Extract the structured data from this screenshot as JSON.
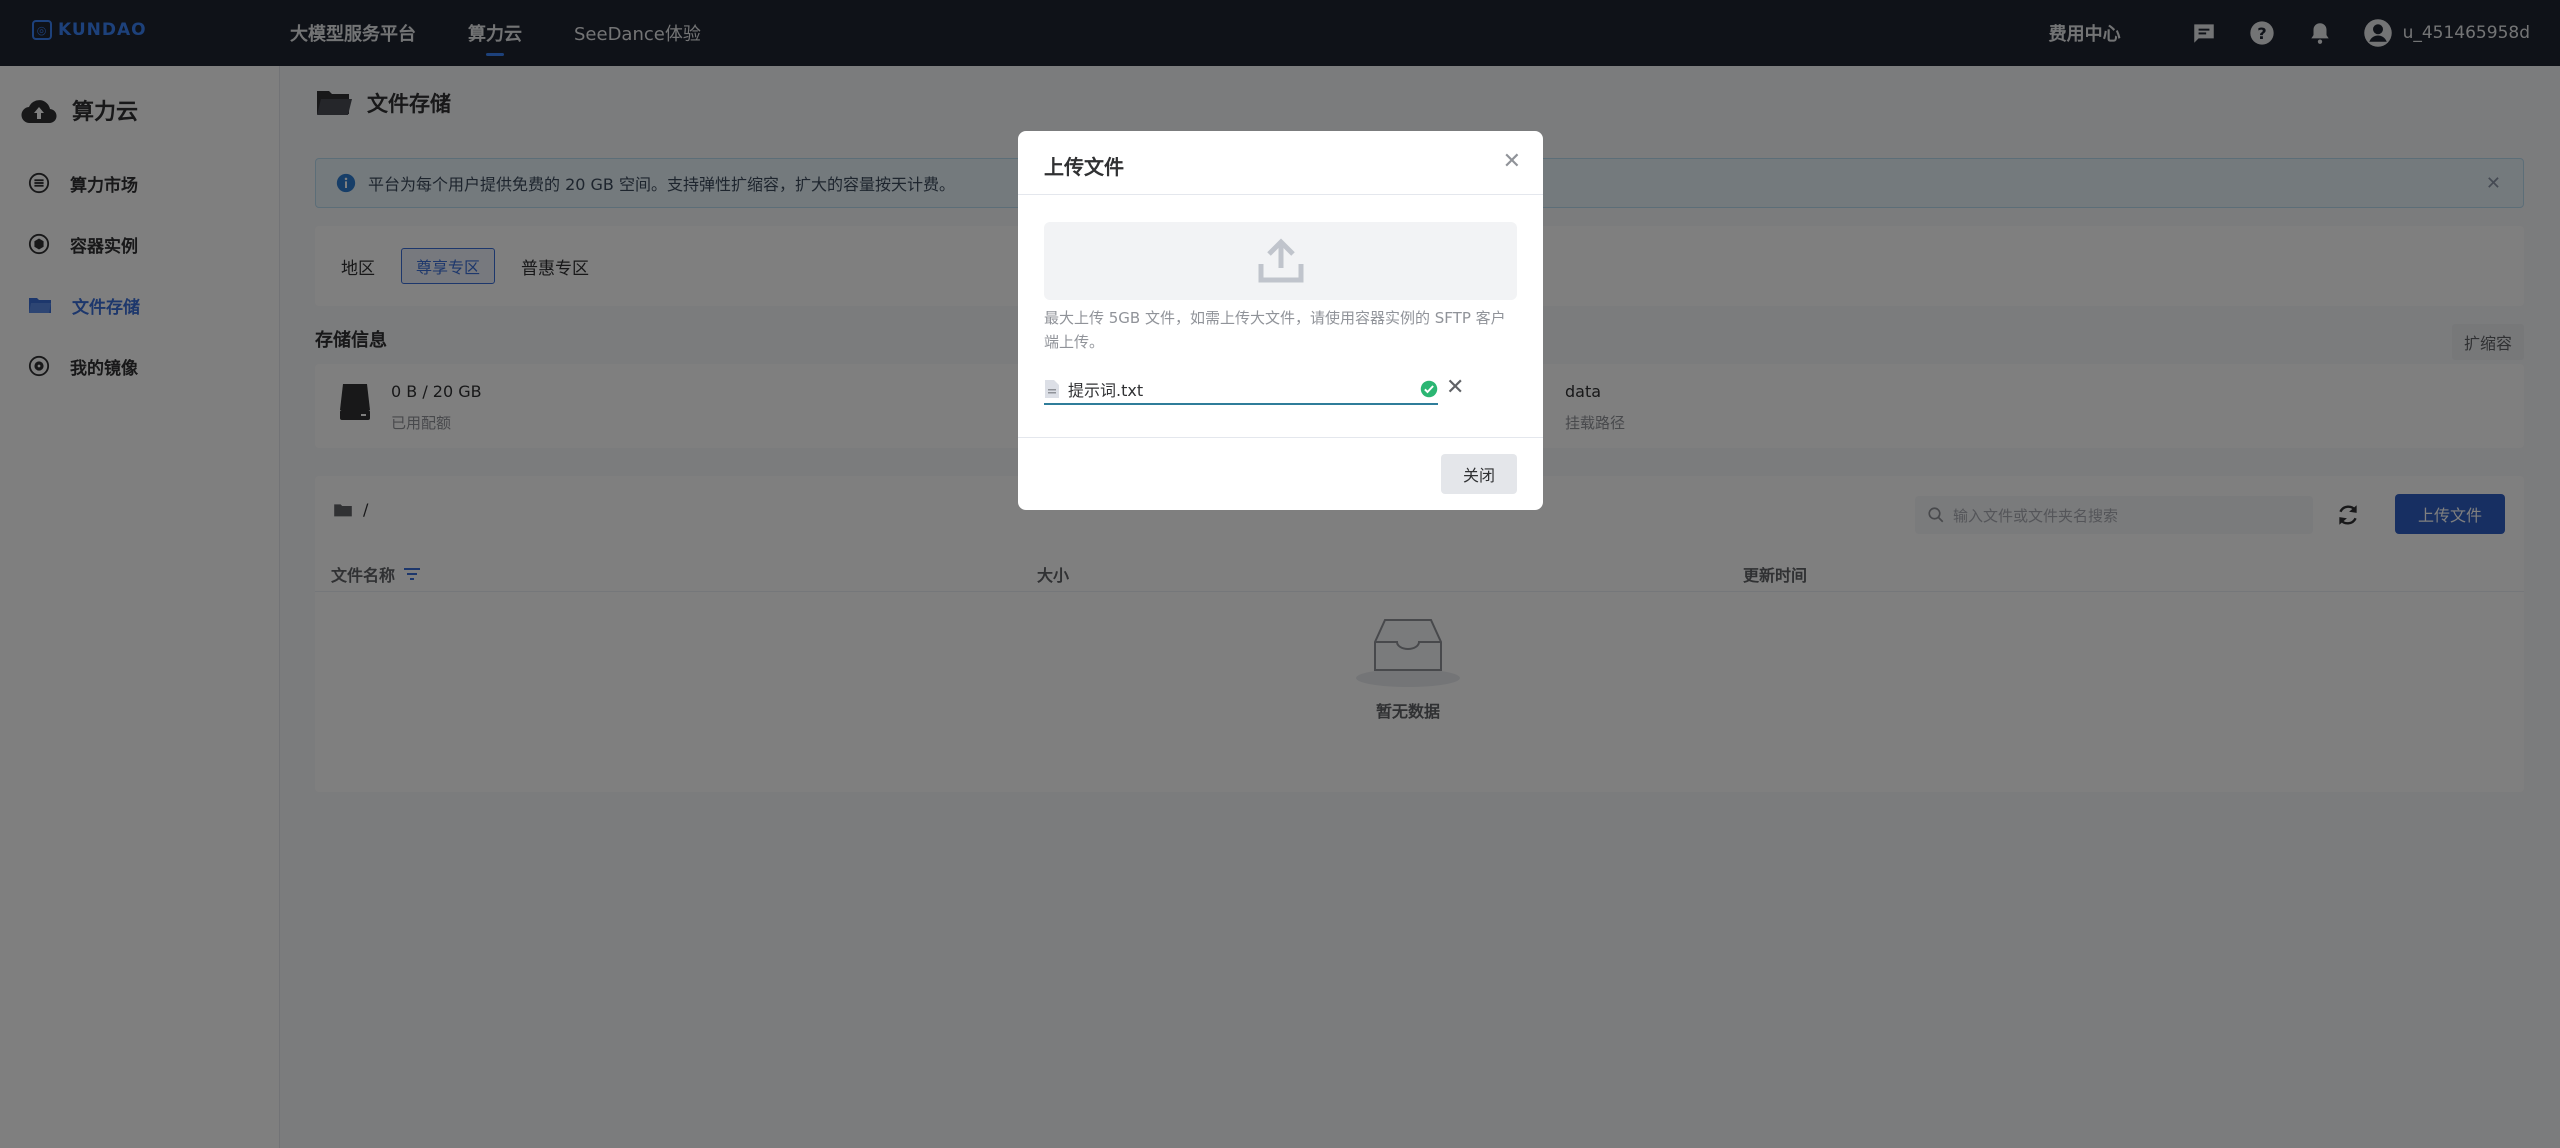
{
  "brand": {
    "logo_text": "KUNDAO"
  },
  "topnav": {
    "items": [
      {
        "label": "大模型服务平台"
      },
      {
        "label": "算力云"
      },
      {
        "label": "SeeDance体验"
      }
    ],
    "fee_center": "费用中心",
    "user_name": "u_451465958d"
  },
  "sidebar": {
    "title": "算力云",
    "items": [
      {
        "label": "算力市场"
      },
      {
        "label": "容器实例"
      },
      {
        "label": "文件存储"
      },
      {
        "label": "我的镜像"
      }
    ]
  },
  "main": {
    "page_title": "文件存储",
    "alert_text": "平台为每个用户提供免费的 20 GB 空间。支持弹性扩缩容，扩大的容量按天计费。",
    "region": {
      "label": "地区",
      "options": [
        "尊享专区",
        "普惠专区"
      ]
    },
    "storage_section": "存储信息",
    "expand_button": "扩缩容",
    "storage": {
      "value": "0 B / 20 GB",
      "value_label": "已用配额",
      "path_value": "data",
      "path_label": "挂载路径"
    },
    "files": {
      "path": "/",
      "search_placeholder": "输入文件或文件夹名搜索",
      "upload_button": "上传文件",
      "columns": [
        "文件名称",
        "大小",
        "更新时间"
      ],
      "empty_text": "暂无数据"
    }
  },
  "dialog": {
    "title": "上传文件",
    "tip": "最大上传 5GB 文件，如需上传大文件，请使用容器实例的 SFTP 客户端上传。",
    "file_name": "提示词.txt",
    "close_button": "关闭"
  },
  "colors": {
    "accent": "#2f5ec4",
    "topbar": "#1f2430",
    "success": "#2bb673"
  }
}
